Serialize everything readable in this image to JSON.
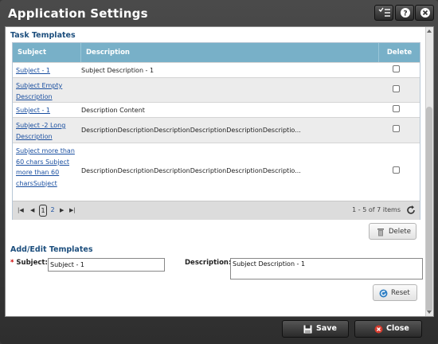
{
  "window": {
    "title": "Application Settings"
  },
  "titlebar_icons": [
    "checklist-icon",
    "help-icon",
    "close-icon"
  ],
  "task_templates": {
    "title": "Task Templates",
    "columns": {
      "subject": "Subject",
      "description": "Description",
      "delete": "Delete"
    },
    "rows": [
      {
        "subject": "Subject - 1",
        "description": "Subject Description - 1",
        "delete": false
      },
      {
        "subject": "Subject Empty Description",
        "description": "",
        "delete": false
      },
      {
        "subject": "Subject - 1",
        "description": "Description Content",
        "delete": false
      },
      {
        "subject": "Subject -2 Long Description",
        "description": "DescriptionDescriptionDescriptionDescriptionDescriptionDescriptio...",
        "delete": false
      },
      {
        "subject": "Subject more than 60 chars Subject more than 60 charsSubject",
        "description": "DescriptionDescriptionDescriptionDescriptionDescriptionDescriptio...",
        "delete": false
      }
    ],
    "pager": {
      "pages": [
        "1",
        "2"
      ],
      "current": "1",
      "info": "1 - 5 of 7 items"
    },
    "delete_label": "Delete"
  },
  "edit": {
    "title": "Add/Edit Templates",
    "subject_label": "Subject:",
    "subject_value": "Subject - 1",
    "description_label": "Description:",
    "description_value": "Subject Description - 1",
    "required_mark": "*",
    "reset_label": "Reset"
  },
  "footer": {
    "save_label": "Save",
    "close_label": "Close"
  },
  "colors": {
    "accent": "#1c4e7d",
    "grid_header": "#78b0c8",
    "link": "#1a4fa0",
    "danger": "#d63b2e"
  }
}
